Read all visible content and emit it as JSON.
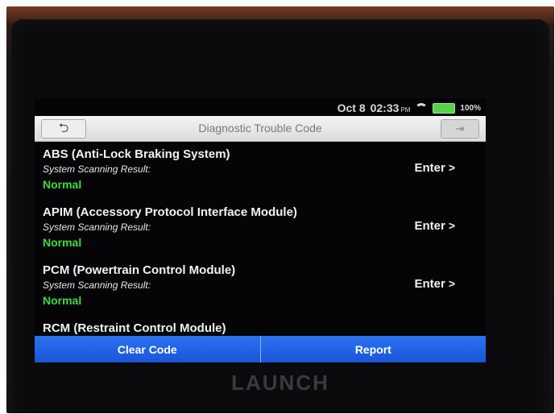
{
  "status_bar": {
    "date": "Oct 8",
    "time": "02:33",
    "ampm": "PM",
    "battery": "100%"
  },
  "header": {
    "title": "Diagnostic Trouble Code",
    "back_icon": "back-arrow-icon",
    "exit_icon": "exit-icon"
  },
  "modules": [
    {
      "name": "ABS (Anti-Lock Braking System)",
      "scan_label": "System Scanning Result:",
      "scan_value": "Normal",
      "enter_label": "Enter"
    },
    {
      "name": "APIM (Accessory Protocol Interface Module)",
      "scan_label": "System Scanning Result:",
      "scan_value": "Normal",
      "enter_label": "Enter"
    },
    {
      "name": "PCM (Powertrain Control Module)",
      "scan_label": "System Scanning Result:",
      "scan_value": "Normal",
      "enter_label": "Enter"
    },
    {
      "name": "RCM (Restraint Control Module)"
    }
  ],
  "footer": {
    "clear_code_label": "Clear Code",
    "report_label": "Report"
  },
  "device": {
    "brand": "LAUNCH"
  },
  "colors": {
    "accent_blue": "#1f63e6",
    "status_green": "#3ddb3d"
  }
}
